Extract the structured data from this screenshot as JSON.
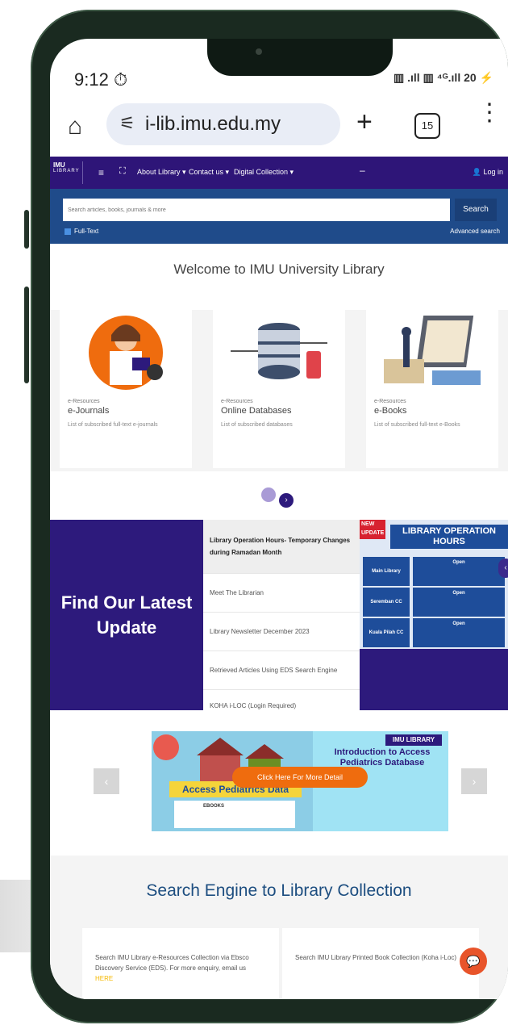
{
  "status": {
    "time": "9:12",
    "icons": "▥ .ıll ▥ ⁴ᴳ.ıll 20 ⚡"
  },
  "browser": {
    "url": "i-lib.imu.edu.my",
    "tab_count": "15"
  },
  "nav": {
    "logo_top": "IMU",
    "logo_bottom": "LIBRARY",
    "menu_about": "About Library ▾",
    "menu_contact": "Contact us ▾",
    "menu_digital": "Digital Collection ▾",
    "login": "Log in"
  },
  "search": {
    "placeholder": "Search articles, books, journals & more",
    "button": "Search",
    "fulltext": "Full-Text",
    "advanced": "Advanced search"
  },
  "welcome": "Welcome to IMU University Library",
  "cards": [
    {
      "category": "e-Resources",
      "title": "e-Journals",
      "desc": "List of subscribed full-text e-journals"
    },
    {
      "category": "e-Resources",
      "title": "Online Databases",
      "desc": "List of subscribed databases"
    },
    {
      "category": "e-Resources",
      "title": "e-Books",
      "desc": "List of subscribed full-text e-Books"
    }
  ],
  "updates": {
    "heading": "Find Our Latest Update",
    "items": [
      "Library Operation Hours- Temporary Changes during Ramadan Month",
      "Meet The Librarian",
      "Library Newsletter December 2023",
      "Retrieved Articles Using EDS Search Engine",
      "KOHA i-LOC (Login Required)"
    ]
  },
  "hours": {
    "badge": "NEW UPDATE",
    "title": "LIBRARY OPERATION HOURS",
    "rows": [
      {
        "location": "Main Library",
        "status": "Open"
      },
      {
        "location": "Seremban CC",
        "status": "Open"
      },
      {
        "location": "Kuala Pilah CC",
        "status": "Open"
      }
    ]
  },
  "promo": {
    "left_title": "Access Pediatrics Data",
    "right_title": "Introduction to Access Pediatrics Database",
    "library": "IMU LIBRARY",
    "cta": "Click Here For More Detail",
    "doc": "EBOOKS"
  },
  "search_engine": {
    "title": "Search Engine to Library Collection",
    "eds_text": "Search IMU Library e-Resources Collection via Ebsco Discovery Service (EDS). For more enquiry, email us",
    "eds_link": "HERE",
    "koha_text": "Search IMU Library Printed Book Collection (Koha i-Loc)"
  }
}
